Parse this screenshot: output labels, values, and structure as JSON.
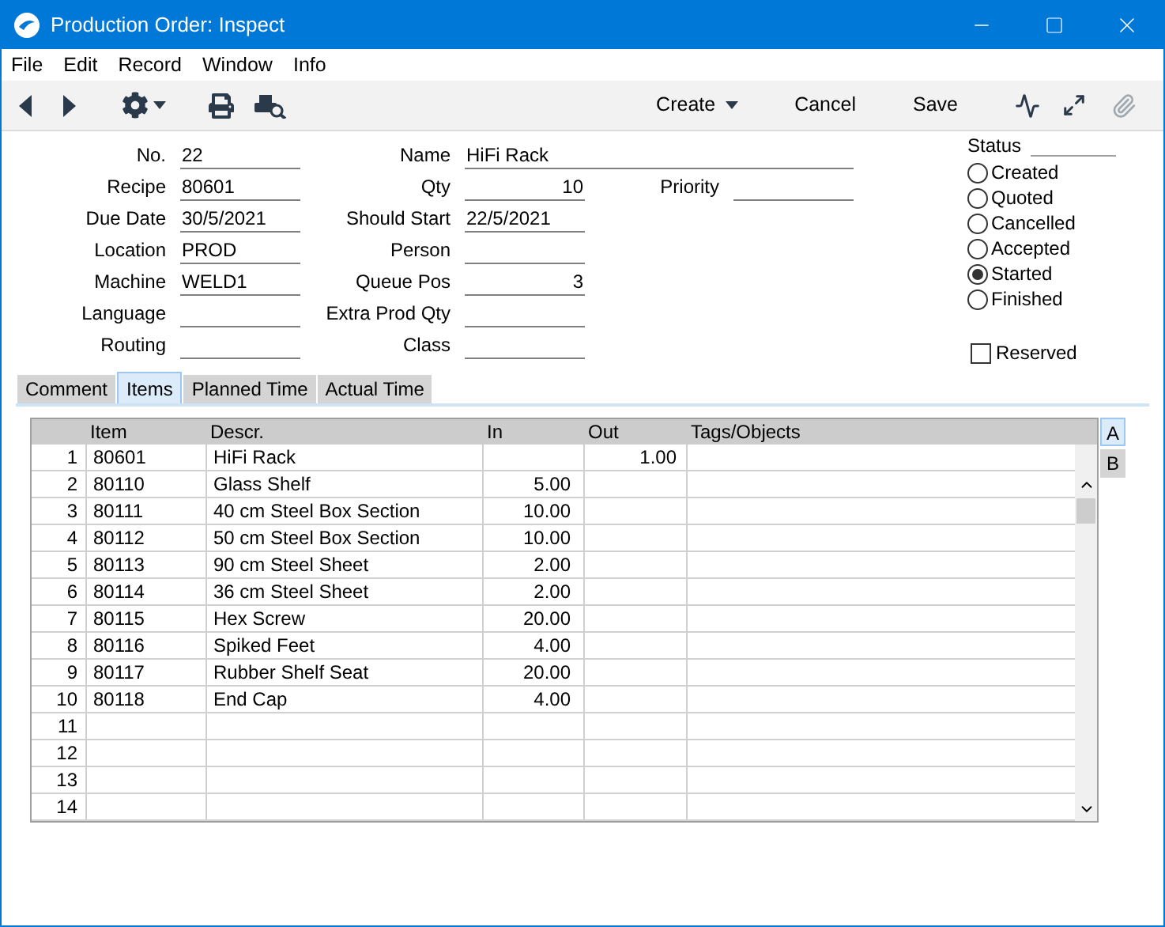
{
  "window": {
    "title": "Production Order: Inspect"
  },
  "menu": [
    "File",
    "Edit",
    "Record",
    "Window",
    "Info"
  ],
  "toolbar": {
    "buttons": [
      {
        "label": "Create",
        "dropdown": true
      },
      {
        "label": "Cancel",
        "dropdown": false
      },
      {
        "label": "Save",
        "dropdown": false
      }
    ]
  },
  "form": {
    "left": [
      {
        "label": "No.",
        "value": "22"
      },
      {
        "label": "Recipe",
        "value": "80601"
      },
      {
        "label": "Due Date",
        "value": "30/5/2021"
      },
      {
        "label": "Location",
        "value": "PROD"
      },
      {
        "label": "Machine",
        "value": "WELD1"
      },
      {
        "label": "Language"
      },
      {
        "label": "Routing"
      }
    ],
    "middle": [
      {
        "label": "Name",
        "value": "HiFi Rack",
        "wide": true
      },
      {
        "label": "Qty",
        "value": "10",
        "numeric": true
      },
      {
        "label": "Should Start",
        "value": "22/5/2021"
      },
      {
        "label": "Person"
      },
      {
        "label": "Queue Pos",
        "value": "3",
        "numeric": true
      },
      {
        "label": "Extra Prod Qty"
      },
      {
        "label": "Class"
      }
    ],
    "priority": {
      "label": "Priority"
    }
  },
  "status": {
    "label": "Status",
    "options": [
      {
        "label": "Created",
        "selected": false
      },
      {
        "label": "Quoted",
        "selected": false
      },
      {
        "label": "Cancelled",
        "selected": false
      },
      {
        "label": "Accepted",
        "selected": false
      },
      {
        "label": "Started",
        "selected": true
      },
      {
        "label": "Finished",
        "selected": false
      }
    ]
  },
  "reserved": {
    "label": "Reserved",
    "checked": false
  },
  "tabs": [
    {
      "label": "Comment",
      "selected": false
    },
    {
      "label": "Items",
      "selected": true
    },
    {
      "label": "Planned Time",
      "selected": false
    },
    {
      "label": "Actual Time",
      "selected": false
    }
  ],
  "table": {
    "columns": [
      "Item",
      "Descr.",
      "In",
      "Out",
      "Tags/Objects"
    ],
    "rows": [
      {
        "number": "1",
        "item": "80601",
        "descr": "HiFi Rack",
        "out": "1.00"
      },
      {
        "number": "2",
        "item": "80110",
        "descr": "Glass Shelf",
        "in": "5.00"
      },
      {
        "number": "3",
        "item": "80111",
        "descr": "40 cm Steel Box Section",
        "in": "10.00"
      },
      {
        "number": "4",
        "item": "80112",
        "descr": "50 cm Steel Box Section",
        "in": "10.00"
      },
      {
        "number": "5",
        "item": "80113",
        "descr": "90 cm Steel Sheet",
        "in": "2.00"
      },
      {
        "number": "6",
        "item": "80114",
        "descr": "36 cm Steel Sheet",
        "in": "2.00"
      },
      {
        "number": "7",
        "item": "80115",
        "descr": "Hex Screw",
        "in": "20.00"
      },
      {
        "number": "8",
        "item": "80116",
        "descr": "Spiked Feet",
        "in": "4.00"
      },
      {
        "number": "9",
        "item": "80117",
        "descr": "Rubber Shelf Seat",
        "in": "20.00"
      },
      {
        "number": "10",
        "item": "80118",
        "descr": "End Cap",
        "in": "4.00"
      },
      {
        "number": "11"
      },
      {
        "number": "12"
      },
      {
        "number": "13"
      },
      {
        "number": "14"
      }
    ]
  },
  "side_tabs": [
    {
      "label": "A",
      "selected": true
    },
    {
      "label": "B",
      "selected": false
    }
  ]
}
